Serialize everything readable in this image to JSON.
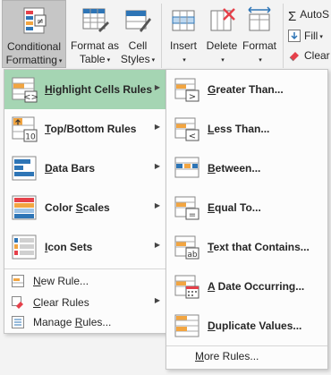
{
  "ribbon": {
    "conditional_formatting": {
      "line1": "Conditional",
      "line2": "Formatting"
    },
    "format_as_table": {
      "line1": "Format as",
      "line2": "Table"
    },
    "cell_styles": {
      "line1": "Cell",
      "line2": "Styles"
    },
    "insert": {
      "line1": "Insert"
    },
    "delete": {
      "line1": "Delete"
    },
    "format": {
      "line1": "Format"
    },
    "autosum": "AutoS",
    "fill": "Fill",
    "clear": "Clear",
    "caret": "▾"
  },
  "menu": {
    "items": [
      {
        "label": "Highlight Cells Rules",
        "icon": "highlight-cells-icon",
        "mnemonic": "H",
        "rest": "ighlight Cells Rules"
      },
      {
        "label": "Top/Bottom Rules",
        "icon": "top-bottom-icon",
        "mnemonic": "T",
        "rest": "op/Bottom Rules"
      },
      {
        "label": "Data Bars",
        "icon": "data-bars-icon",
        "mnemonic": "D",
        "rest": "ata Bars"
      },
      {
        "label": "Color Scales",
        "icon": "color-scales-icon",
        "mnemonic": "S",
        "pre": "Color ",
        "rest": "cales"
      },
      {
        "label": "Icon Sets",
        "icon": "icon-sets-icon",
        "mnemonic": "I",
        "rest": "con Sets"
      }
    ],
    "small_items": [
      {
        "label": "New Rule...",
        "mnemonic": "N",
        "rest": "ew Rule..."
      },
      {
        "label": "Clear Rules",
        "mnemonic": "C",
        "rest": "lear Rules"
      },
      {
        "label": "Manage Rules...",
        "pre": "Manage ",
        "mnemonic": "R",
        "rest": "ules..."
      }
    ],
    "arrow": "▶"
  },
  "submenu": {
    "items": [
      {
        "label": "Greater Than...",
        "mnemonic": "G",
        "rest": "reater Than..."
      },
      {
        "label": "Less Than...",
        "mnemonic": "L",
        "rest": "ess Than..."
      },
      {
        "label": "Between...",
        "mnemonic": "B",
        "rest": "etween..."
      },
      {
        "label": "Equal To...",
        "mnemonic": "E",
        "rest": "qual To..."
      },
      {
        "label": "Text that Contains...",
        "mnemonic": "T",
        "rest": "ext that Contains..."
      },
      {
        "label": "A Date Occurring...",
        "mnemonic": "A",
        "rest": " Date Occurring..."
      },
      {
        "label": "Duplicate Values...",
        "mnemonic": "D",
        "rest": "uplicate Values..."
      }
    ],
    "more": {
      "label": "More Rules...",
      "pre": "",
      "mnemonic": "M",
      "rest": "ore Rules..."
    },
    "glyphs": {
      "greater": ">",
      "less": "<",
      "ab": "ab",
      "ten": "10",
      "eq": "="
    }
  },
  "colors": {
    "highlight": "#a5d5b3",
    "accent_green": "#217346",
    "orange": "#f2a541",
    "blue": "#2e75b6",
    "red": "#e5404a"
  }
}
